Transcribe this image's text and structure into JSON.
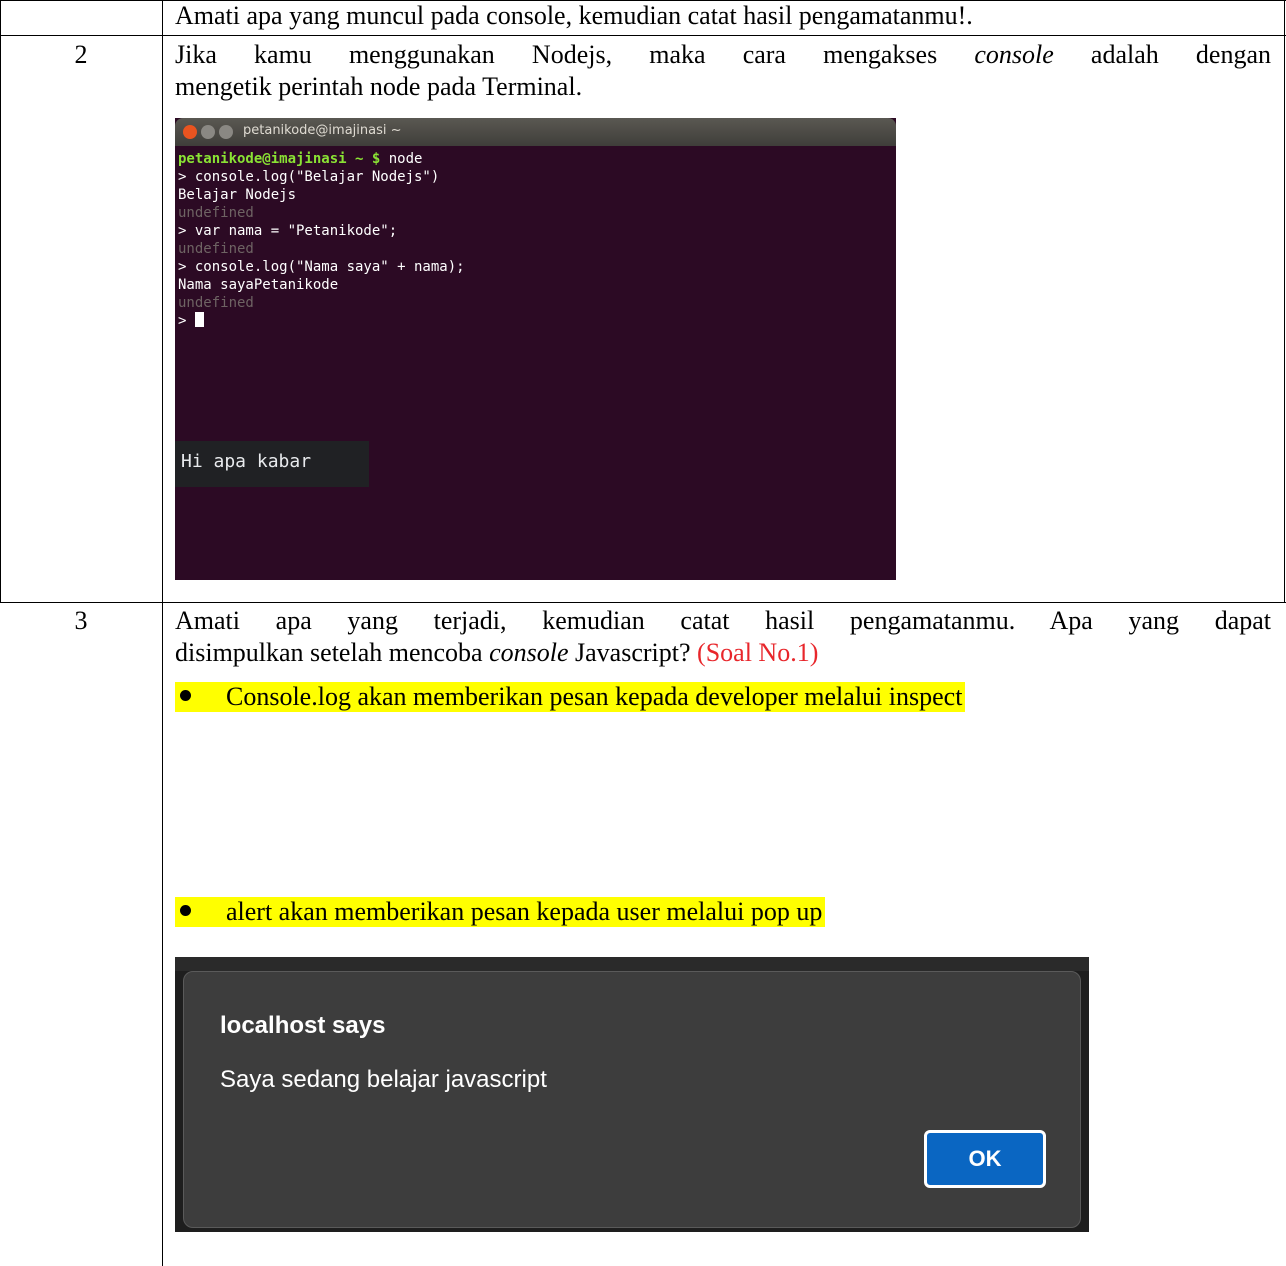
{
  "rows": [
    {
      "number": "",
      "text": "Amati apa yang muncul pada console, kemudian catat hasil pengamatanmu!."
    },
    {
      "number": "2",
      "line1_pre": "Jika kamu menggunakan Nodejs, maka cara mengakses ",
      "line1_em": "console",
      "line1_post": " adalah dengan",
      "line2": "mengetik perintah node pada Terminal."
    },
    {
      "number": "3",
      "line1": "Amati apa yang terjadi, kemudian catat hasil pengamatanmu. Apa yang dapat",
      "line2_pre": "disimpulkan setelah mencoba ",
      "line2_em": "console",
      "line2_post": " Javascript? ",
      "line2_red": "(Soal No.1)",
      "bullet1": "Console.log akan memberikan pesan kepada developer melalui inspect",
      "bullet2": "alert akan memberikan pesan kepada user melalui pop up"
    }
  ],
  "terminal": {
    "title": "petanikode@imajinasi ~",
    "prompt": "petanikode@imajinasi ~ $",
    "command": " node",
    "lines": [
      "> console.log(\"Belajar Nodejs\")",
      "Belajar Nodejs",
      "undefined",
      "> var nama = \"Petanikode\";",
      "undefined",
      "> console.log(\"Nama saya\" + nama);",
      "Nama sayaPetanikode",
      "undefined",
      "> "
    ]
  },
  "console_output": "Hi apa kabar",
  "alert": {
    "title": "localhost says",
    "message": "Saya sedang belajar javascript",
    "ok_label": "OK",
    "accent": "#0a66c2"
  },
  "colors": {
    "highlight": "#ffff00",
    "red_text": "#e8262b",
    "terminal_bg": "#2c0a24",
    "terminal_prompt": "#8ae234"
  }
}
